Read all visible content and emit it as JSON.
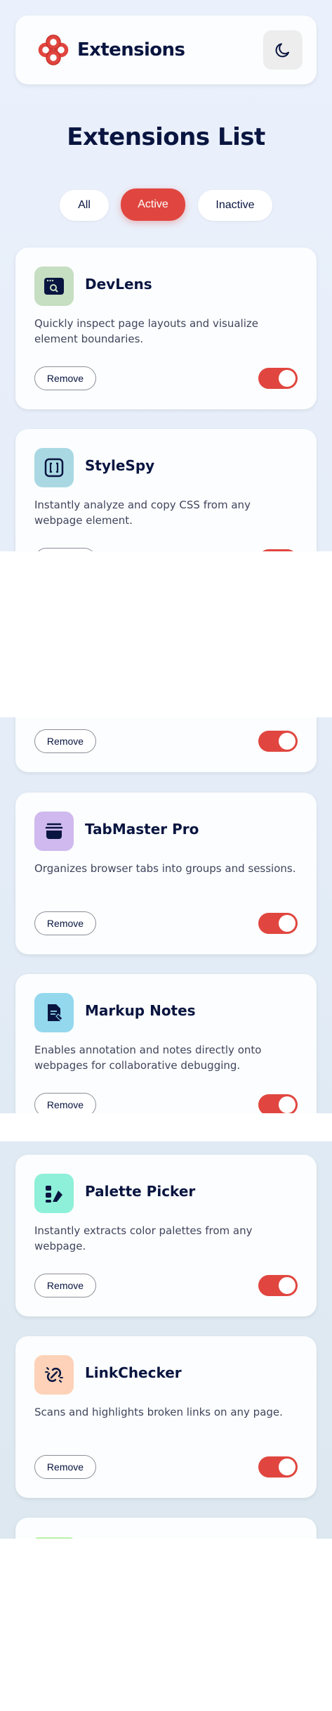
{
  "header": {
    "title": "Extensions",
    "theme_icon": "moon-icon"
  },
  "page_title": "Extensions List",
  "filters": [
    {
      "label": "All",
      "active": false
    },
    {
      "label": "Active",
      "active": true
    },
    {
      "label": "Inactive",
      "active": false
    }
  ],
  "remove_label": "Remove",
  "colors": {
    "accent": "#e0463f",
    "text": "#091540"
  },
  "extensions": [
    {
      "name": "DevLens",
      "description": "Quickly inspect page layouts and visualize element boundaries.",
      "icon": "devlens-icon",
      "icon_bg": "#c6dec1",
      "enabled": true
    },
    {
      "name": "StyleSpy",
      "description": "Instantly analyze and copy CSS from any webpage element.",
      "icon": "stylespy-icon",
      "icon_bg": "#a9d8e3",
      "enabled": true
    },
    {
      "name": "",
      "description": "",
      "icon": "",
      "icon_bg": "",
      "enabled": true
    },
    {
      "name": "TabMaster Pro",
      "description": "Organizes browser tabs into groups and sessions.",
      "icon": "tabmaster-icon",
      "icon_bg": "#cfb9ee",
      "enabled": true
    },
    {
      "name": "Markup Notes",
      "description": "Enables annotation and notes directly onto webpages for collaborative debugging.",
      "icon": "markup-notes-icon",
      "icon_bg": "#94d8ee",
      "enabled": true
    },
    {
      "name": "Palette Picker",
      "description": "Instantly extracts color palettes from any webpage.",
      "icon": "palette-picker-icon",
      "icon_bg": "#8ef0d8",
      "enabled": true
    },
    {
      "name": "LinkChecker",
      "description": "Scans and highlights broken links on any page.",
      "icon": "linkchecker-icon",
      "icon_bg": "#fdd2b8",
      "enabled": true
    }
  ]
}
